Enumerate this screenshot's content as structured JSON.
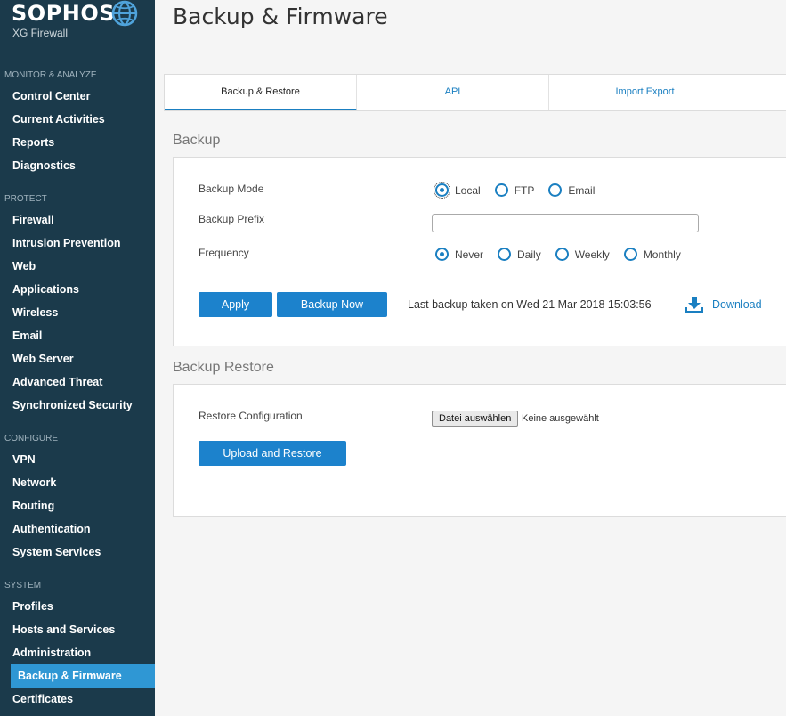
{
  "brand": {
    "name": "SOPHOS",
    "product": "XG Firewall"
  },
  "sidebar": {
    "sections": [
      {
        "title": "MONITOR & ANALYZE",
        "items": [
          "Control Center",
          "Current Activities",
          "Reports",
          "Diagnostics"
        ]
      },
      {
        "title": "PROTECT",
        "items": [
          "Firewall",
          "Intrusion Prevention",
          "Web",
          "Applications",
          "Wireless",
          "Email",
          "Web Server",
          "Advanced Threat",
          "Synchronized Security"
        ]
      },
      {
        "title": "CONFIGURE",
        "items": [
          "VPN",
          "Network",
          "Routing",
          "Authentication",
          "System Services"
        ]
      },
      {
        "title": "SYSTEM",
        "items": [
          "Profiles",
          "Hosts and Services",
          "Administration",
          "Backup & Firmware",
          "Certificates"
        ]
      }
    ],
    "active": "Backup & Firmware"
  },
  "page": {
    "title": "Backup & Firmware"
  },
  "tabs": [
    {
      "label": "Backup & Restore",
      "active": true
    },
    {
      "label": "API",
      "active": false
    },
    {
      "label": "Import Export",
      "active": false
    }
  ],
  "backup": {
    "heading": "Backup",
    "mode_label": "Backup Mode",
    "mode_options": [
      "Local",
      "FTP",
      "Email"
    ],
    "mode_selected": "Local",
    "prefix_label": "Backup Prefix",
    "prefix_value": "",
    "frequency_label": "Frequency",
    "frequency_options": [
      "Never",
      "Daily",
      "Weekly",
      "Monthly"
    ],
    "frequency_selected": "Never",
    "apply_label": "Apply",
    "backup_now_label": "Backup Now",
    "last_backup_text": "Last backup taken on Wed 21 Mar 2018 15:03:56",
    "download_label": "Download"
  },
  "restore": {
    "heading": "Backup Restore",
    "config_label": "Restore Configuration",
    "file_button_label": "Datei auswählen",
    "file_status": "Keine ausgewählt",
    "upload_label": "Upload and Restore"
  },
  "colors": {
    "sidebar_bg": "#1b3a4b",
    "accent": "#1c82cc",
    "active_nav": "#2f97d4"
  },
  "icons": {
    "logo": "globe-icon",
    "download": "download-icon"
  }
}
